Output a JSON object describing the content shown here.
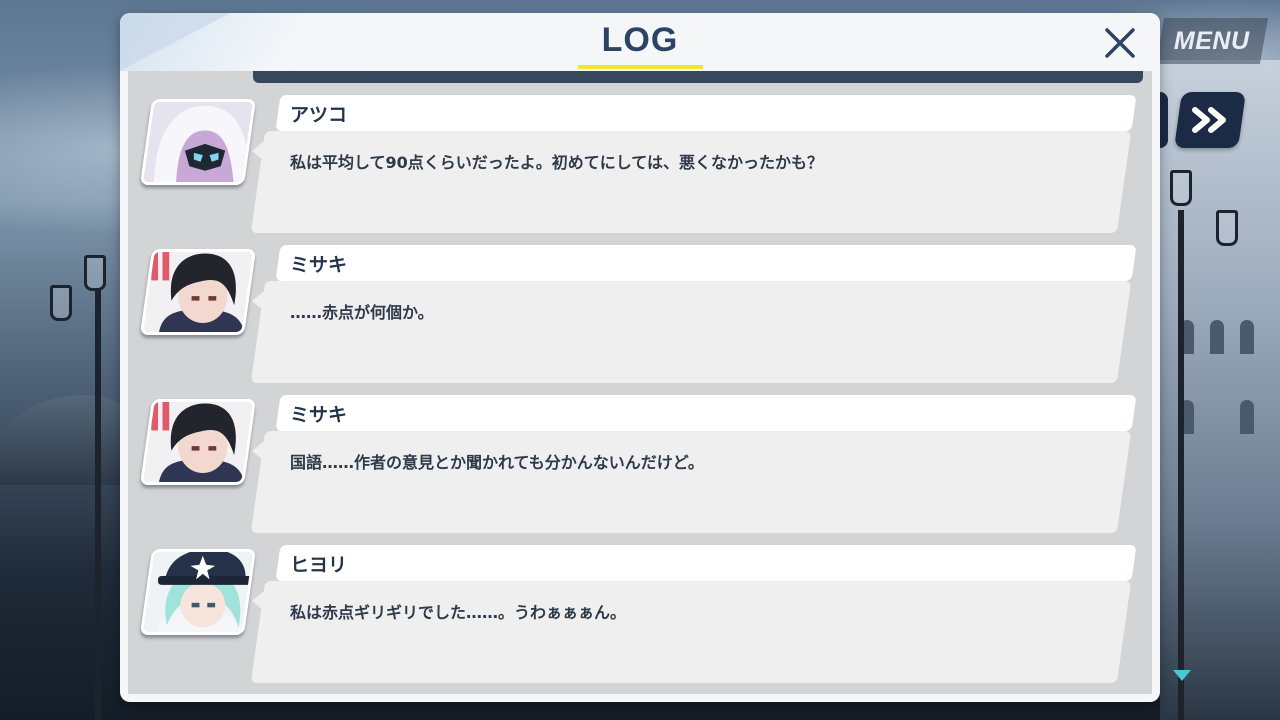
{
  "hud": {
    "menu_label": "MENU",
    "skip_icon": "fast-forward-icon"
  },
  "log": {
    "title": "LOG",
    "close_icon": "close-icon",
    "entries": [
      {
        "speaker": "アツコ",
        "text": "私は平均して90点くらいだったよ。初めてにしては、悪くなかったかも？",
        "portrait": "atsuko-portrait"
      },
      {
        "speaker": "ミサキ",
        "text": "……赤点が何個か。",
        "portrait": "misaki-portrait"
      },
      {
        "speaker": "ミサキ",
        "text": "国語……作者の意見とか聞かれても分かんないんだけど。",
        "portrait": "misaki-portrait"
      },
      {
        "speaker": "ヒヨリ",
        "text": "私は赤点ギリギリでした……。うわぁぁぁん。",
        "portrait": "hiyori-portrait"
      }
    ]
  },
  "colors": {
    "title": "#2c4366",
    "underline": "#f5e52a",
    "skip_bg": "#1c2b45",
    "scroll_arrow": "#49c7d6"
  }
}
